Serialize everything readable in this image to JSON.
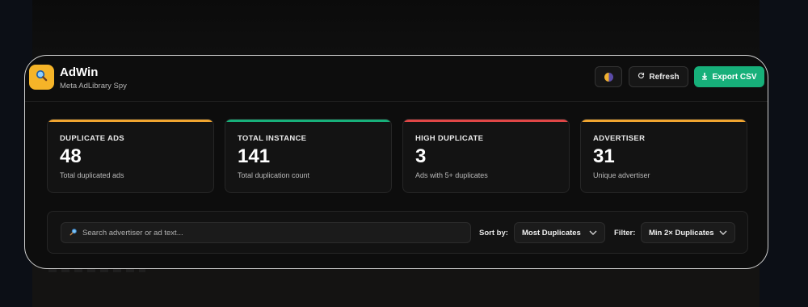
{
  "app": {
    "title": "AdWin",
    "subtitle": "Meta AdLibrary Spy",
    "logo_icon": "search-icon",
    "logo_color": "#f5b428"
  },
  "toolbar": {
    "theme_icon": "theme-toggle-icon",
    "refresh_label": "Refresh",
    "refresh_icon": "refresh-icon",
    "export_label": "Export CSV",
    "export_icon": "download-icon",
    "export_color": "#17b07a"
  },
  "stats": [
    {
      "label": "DUPLICATE ADS",
      "value": "48",
      "desc": "Total duplicated ads",
      "accent": "#f0a530"
    },
    {
      "label": "TOTAL INSTANCE",
      "value": "141",
      "desc": "Total duplication count",
      "accent": "#17b07a"
    },
    {
      "label": "HIGH DUPLICATE",
      "value": "3",
      "desc": "Ads with 5+ duplicates",
      "accent": "#e04646"
    },
    {
      "label": "ADVERTISER",
      "value": "31",
      "desc": "Unique advertiser",
      "accent": "#f0a530"
    }
  ],
  "filters": {
    "search_placeholder": "Search advertiser or ad text...",
    "search_value": "",
    "sort_label": "Sort by:",
    "sort_value": "Most Duplicates",
    "filter_label": "Filter:",
    "filter_value": "Min 2× Duplicates"
  }
}
